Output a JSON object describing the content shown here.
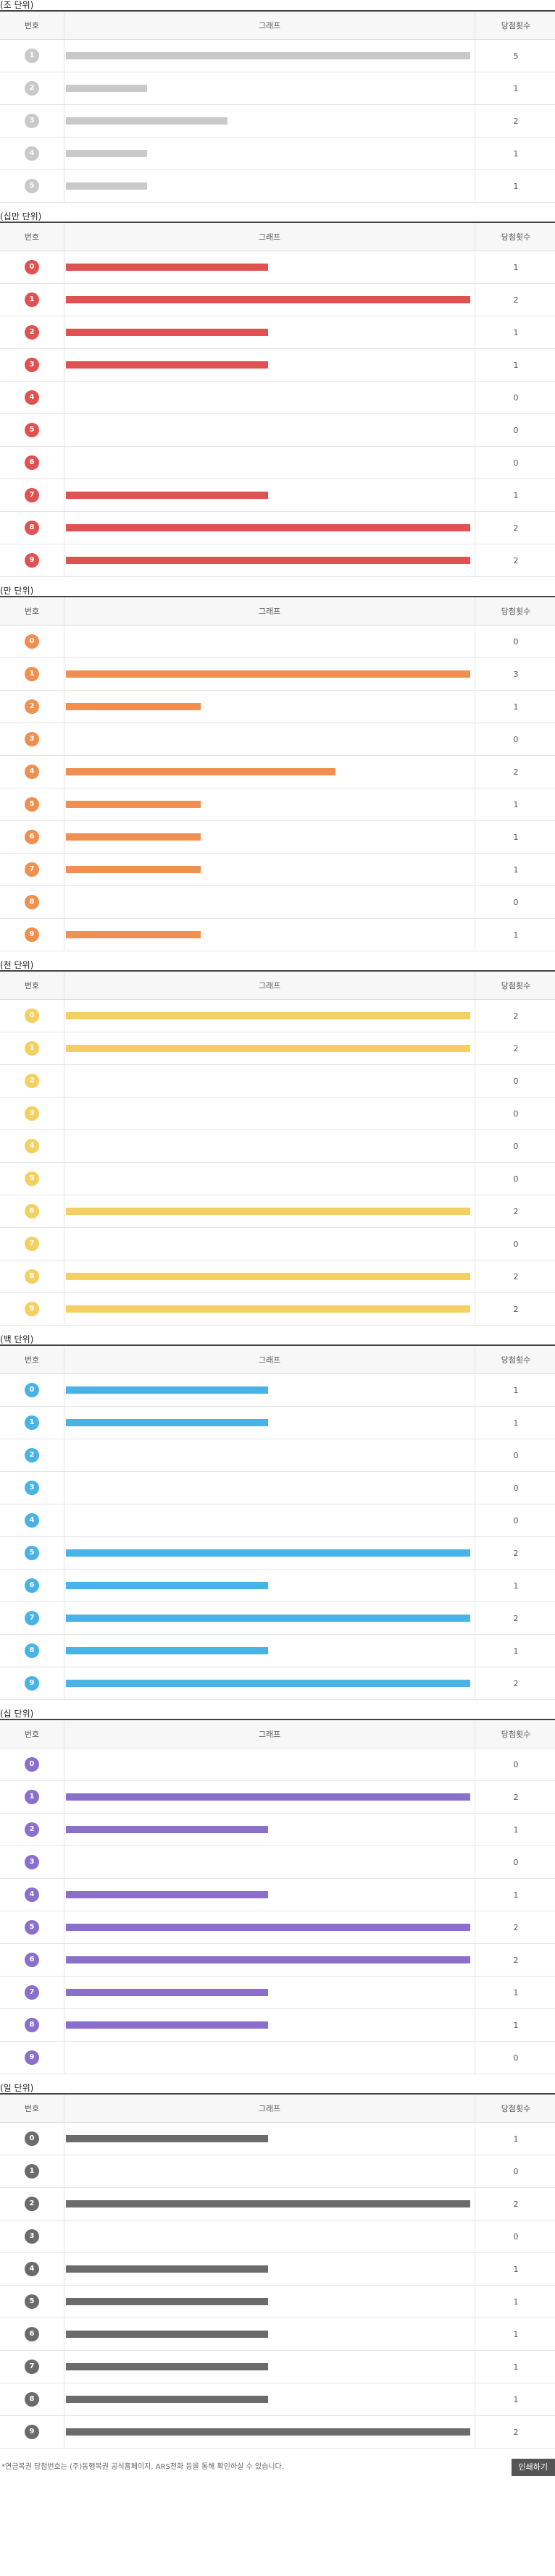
{
  "headers": {
    "num": "번호",
    "graph": "그래프",
    "count": "당첨횟수"
  },
  "sections": [
    {
      "title": "(조 단위)",
      "color": "#c9c9c9",
      "chart_data": {
        "type": "bar",
        "categories": [
          "1",
          "2",
          "3",
          "4",
          "5"
        ],
        "values": [
          5,
          1,
          2,
          1,
          1
        ],
        "max": 5
      }
    },
    {
      "title": "(십만 단위)",
      "color": "#e05252",
      "chart_data": {
        "type": "bar",
        "categories": [
          "0",
          "1",
          "2",
          "3",
          "4",
          "5",
          "6",
          "7",
          "8",
          "9"
        ],
        "values": [
          1,
          2,
          1,
          1,
          0,
          0,
          0,
          1,
          2,
          2
        ],
        "max": 2
      }
    },
    {
      "title": "(만 단위)",
      "color": "#ef8f50",
      "chart_data": {
        "type": "bar",
        "categories": [
          "0",
          "1",
          "2",
          "3",
          "4",
          "5",
          "6",
          "7",
          "8",
          "9"
        ],
        "values": [
          0,
          3,
          1,
          0,
          2,
          1,
          1,
          1,
          0,
          1
        ],
        "max": 3
      }
    },
    {
      "title": "(천 단위)",
      "color": "#f4d060",
      "chart_data": {
        "type": "bar",
        "categories": [
          "0",
          "1",
          "2",
          "3",
          "4",
          "5",
          "6",
          "7",
          "8",
          "9"
        ],
        "values": [
          2,
          2,
          0,
          0,
          0,
          0,
          2,
          0,
          2,
          2
        ],
        "max": 2
      }
    },
    {
      "title": "(백 단위)",
      "color": "#4ab3e6",
      "chart_data": {
        "type": "bar",
        "categories": [
          "0",
          "1",
          "2",
          "3",
          "4",
          "5",
          "6",
          "7",
          "8",
          "9"
        ],
        "values": [
          1,
          1,
          0,
          0,
          0,
          2,
          1,
          2,
          1,
          2
        ],
        "max": 2
      }
    },
    {
      "title": "(십 단위)",
      "color": "#8a6fcc",
      "chart_data": {
        "type": "bar",
        "categories": [
          "0",
          "1",
          "2",
          "3",
          "4",
          "5",
          "6",
          "7",
          "8",
          "9"
        ],
        "values": [
          0,
          2,
          1,
          0,
          1,
          2,
          2,
          1,
          1,
          0
        ],
        "max": 2
      }
    },
    {
      "title": "(일 단위)",
      "color": "#6b6b6b",
      "chart_data": {
        "type": "bar",
        "categories": [
          "0",
          "1",
          "2",
          "3",
          "4",
          "5",
          "6",
          "7",
          "8",
          "9"
        ],
        "values": [
          1,
          0,
          2,
          0,
          1,
          1,
          1,
          1,
          1,
          2
        ],
        "max": 2
      }
    }
  ],
  "footer": {
    "note": "*연금복권 당첨번호는 (주)동행복권 공식홈페이지, ARS전화 등을 통해 확인하실 수 있습니다.",
    "print_label": "인쇄하기"
  }
}
